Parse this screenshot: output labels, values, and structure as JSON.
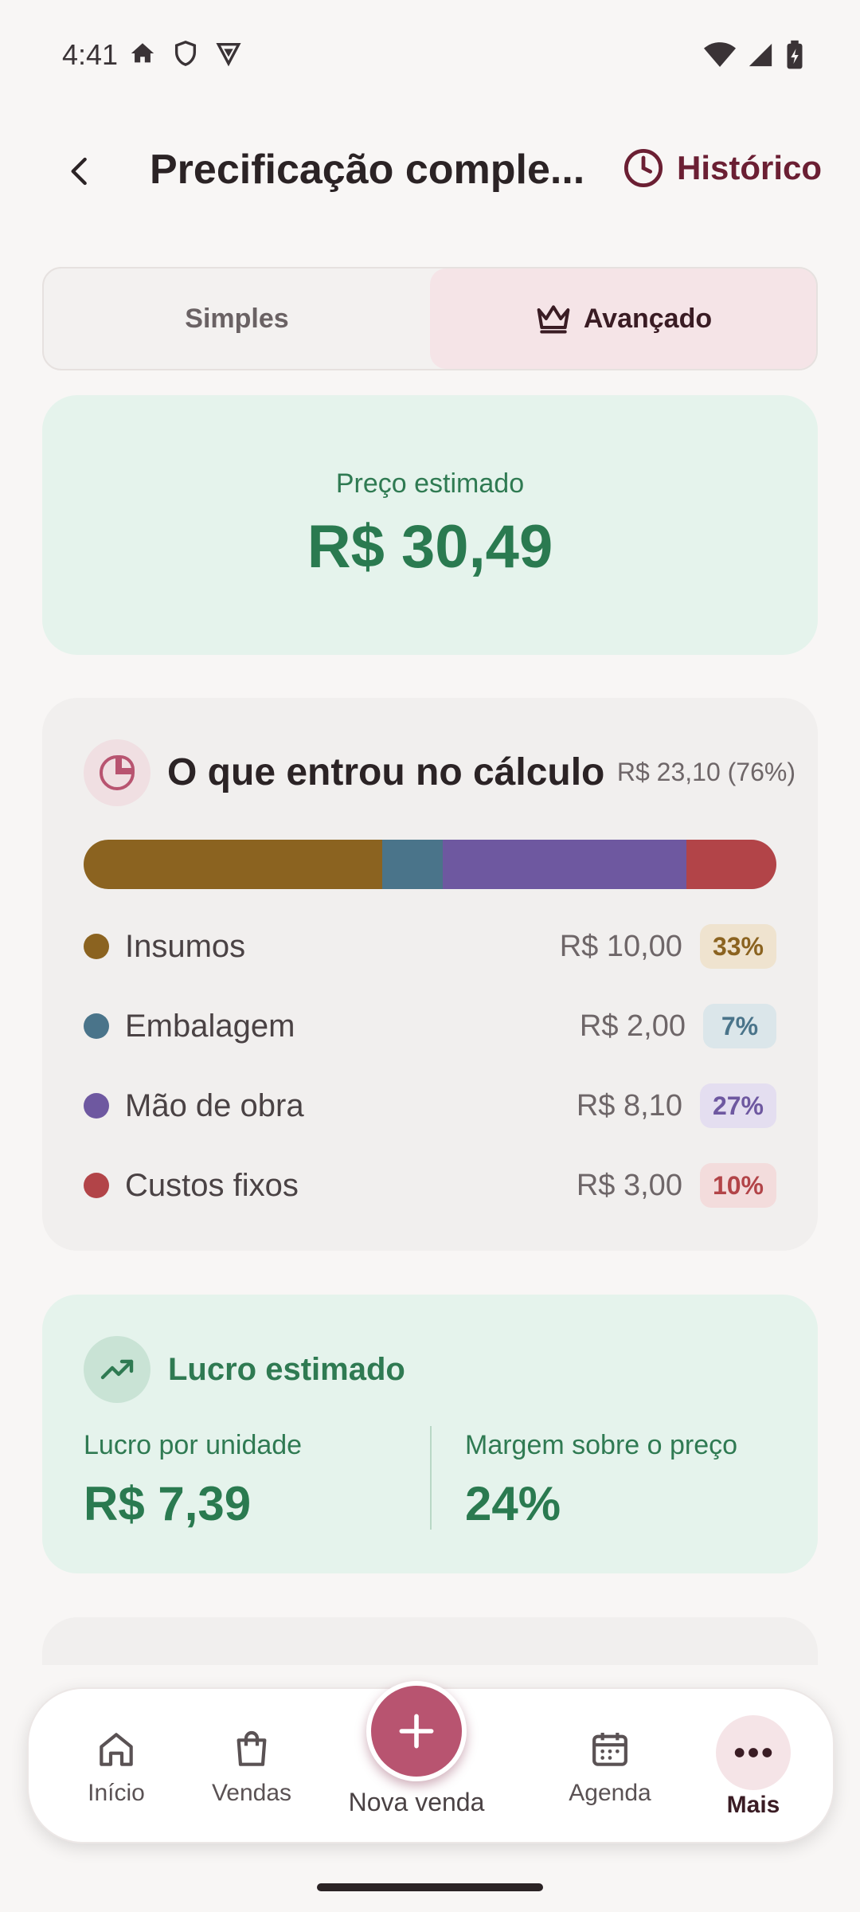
{
  "status_bar": {
    "time": "4:41"
  },
  "header": {
    "title": "Precificação comple...",
    "history_label": "Histórico"
  },
  "tabs": [
    {
      "label": "Simples",
      "active": false
    },
    {
      "label": "Avançado",
      "active": true,
      "icon": "crown-icon"
    }
  ],
  "price_card": {
    "label": "Preço estimado",
    "value": "R$ 30,49"
  },
  "breakdown": {
    "title": "O que entrou no cálculo",
    "total": "R$ 23,10 (76%)",
    "items": [
      {
        "label": "Insumos",
        "value": "R$ 10,00",
        "percent": "33%",
        "color": "#8b6320",
        "badge_bg": "#efe3cf",
        "share": 0.43
      },
      {
        "label": "Embalagem",
        "value": "R$ 2,00",
        "percent": "7%",
        "color": "#4a748a",
        "badge_bg": "#dbe6ea",
        "share": 0.087
      },
      {
        "label": "Mão de obra",
        "value": "R$ 8,10",
        "percent": "27%",
        "color": "#6e58a0",
        "badge_bg": "#e4def0",
        "share": 0.35
      },
      {
        "label": "Custos fixos",
        "value": "R$ 3,00",
        "percent": "10%",
        "color": "#b24448",
        "badge_bg": "#f3dcdc",
        "share": 0.13
      }
    ]
  },
  "profit": {
    "title": "Lucro estimado",
    "per_unit_label": "Lucro por unidade",
    "per_unit_value": "R$ 7,39",
    "margin_label": "Margem sobre o preço",
    "margin_value": "24%"
  },
  "bottom_nav": {
    "items": [
      {
        "label": "Início",
        "icon": "home-icon"
      },
      {
        "label": "Vendas",
        "icon": "shopping-bag-icon"
      },
      {
        "label": "Agenda",
        "icon": "calendar-icon"
      },
      {
        "label": "Mais",
        "icon": "more-icon",
        "active": true
      }
    ],
    "fab_label": "Nova venda"
  },
  "colors": {
    "accent": "#b85470",
    "success": "#2a7a50",
    "brand_dark": "#6b1f33"
  }
}
